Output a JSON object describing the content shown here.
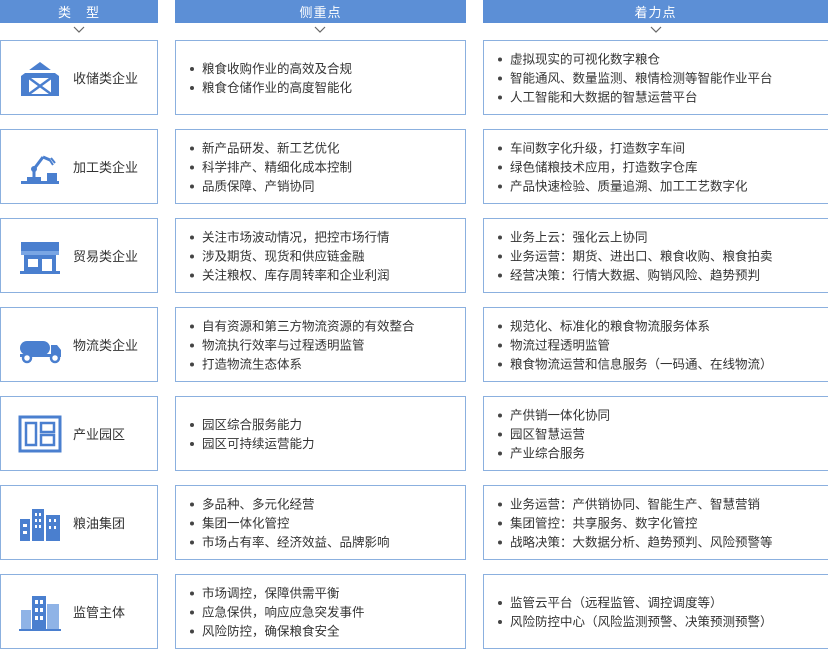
{
  "headers": [
    "类　型",
    "侧重点",
    "着力点"
  ],
  "colors": {
    "header_bg": "#5c8fd6",
    "border": "#8bb0df",
    "icon": "#4a7fcf"
  },
  "rows": [
    {
      "category": "收储类企业",
      "icon": "barn-icon",
      "focus": [
        "粮食收购作业的高效及合规",
        "粮食仓储作业的高度智能化"
      ],
      "efforts": [
        "虚拟现实的可视化数字粮仓",
        "智能通风、数量监测、粮情检测等智能作业平台",
        "人工智能和大数据的智慧运营平台"
      ]
    },
    {
      "category": "加工类企业",
      "icon": "robot-arm-icon",
      "focus": [
        "新产品研发、新工艺优化",
        "科学排产、精细化成本控制",
        "品质保障、产销协同"
      ],
      "efforts": [
        "车间数字化升级，打造数字车间",
        "绿色储粮技术应用，打造数字仓库",
        "产品快速检验、质量追溯、加工工艺数字化"
      ]
    },
    {
      "category": "贸易类企业",
      "icon": "storefront-icon",
      "focus": [
        "关注市场波动情况，把控市场行情",
        "涉及期货、现货和供应链金融",
        "关注粮权、库存周转率和企业利润"
      ],
      "efforts": [
        "业务上云：强化云上协同",
        "业务运营：期货、进出口、粮食收购、粮食拍卖",
        "经营决策：行情大数据、购销风险、趋势预判"
      ]
    },
    {
      "category": "物流类企业",
      "icon": "tanker-truck-icon",
      "focus": [
        "自有资源和第三方物流资源的有效整合",
        "物流执行效率与过程透明监管",
        "打造物流生态体系"
      ],
      "efforts": [
        "规范化、标准化的粮食物流服务体系",
        "物流过程透明监管",
        "粮食物流运营和信息服务（一码通、在线物流）"
      ]
    },
    {
      "category": "产业园区",
      "icon": "park-layout-icon",
      "focus": [
        "园区综合服务能力",
        "园区可持续运营能力"
      ],
      "efforts": [
        "产供销一体化协同",
        "园区智慧运营",
        "产业综合服务"
      ]
    },
    {
      "category": "粮油集团",
      "icon": "city-buildings-icon",
      "focus": [
        "多品种、多元化经营",
        "集团一体化管控",
        "市场占有率、经济效益、品牌影响"
      ],
      "efforts": [
        "业务运营：产供销协同、智能生产、智慧营销",
        "集团管控：共享服务、数字化管控",
        "战略决策：大数据分析、趋势预判、风险预警等"
      ]
    },
    {
      "category": "监管主体",
      "icon": "government-building-icon",
      "focus": [
        "市场调控，保障供需平衡",
        "应急保供，响应应急突发事件",
        "风险防控，确保粮食安全"
      ],
      "efforts": [
        "监管云平台（远程监管、调控调度等）",
        "风险防控中心（风险监测预警、决策预测预警）"
      ]
    }
  ]
}
